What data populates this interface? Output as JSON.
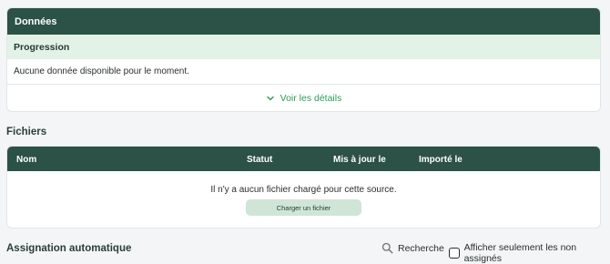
{
  "donnees": {
    "header": "Données",
    "progress_title": "Progression",
    "empty_text": "Aucune donnée disponible pour le moment.",
    "details_link": "Voir les détails"
  },
  "fichiers": {
    "title": "Fichiers",
    "columns": [
      "Nom",
      "Statut",
      "Mis à jour le",
      "Importé le"
    ],
    "empty_text": "Il n'y a aucun fichier chargé pour cette source.",
    "upload_label": "Charger un fichier"
  },
  "assignation": {
    "title": "Assignation automatique",
    "search_label": "Recherche",
    "filter_label": "Afficher seulement les non assignés",
    "filter_checked": false
  },
  "colors": {
    "header_bg": "#2c5147",
    "progress_bg": "#e3f2e7",
    "link_green": "#2d9b5a",
    "button_bg": "#cfe5d8",
    "page_bg": "#f3f5f6"
  }
}
